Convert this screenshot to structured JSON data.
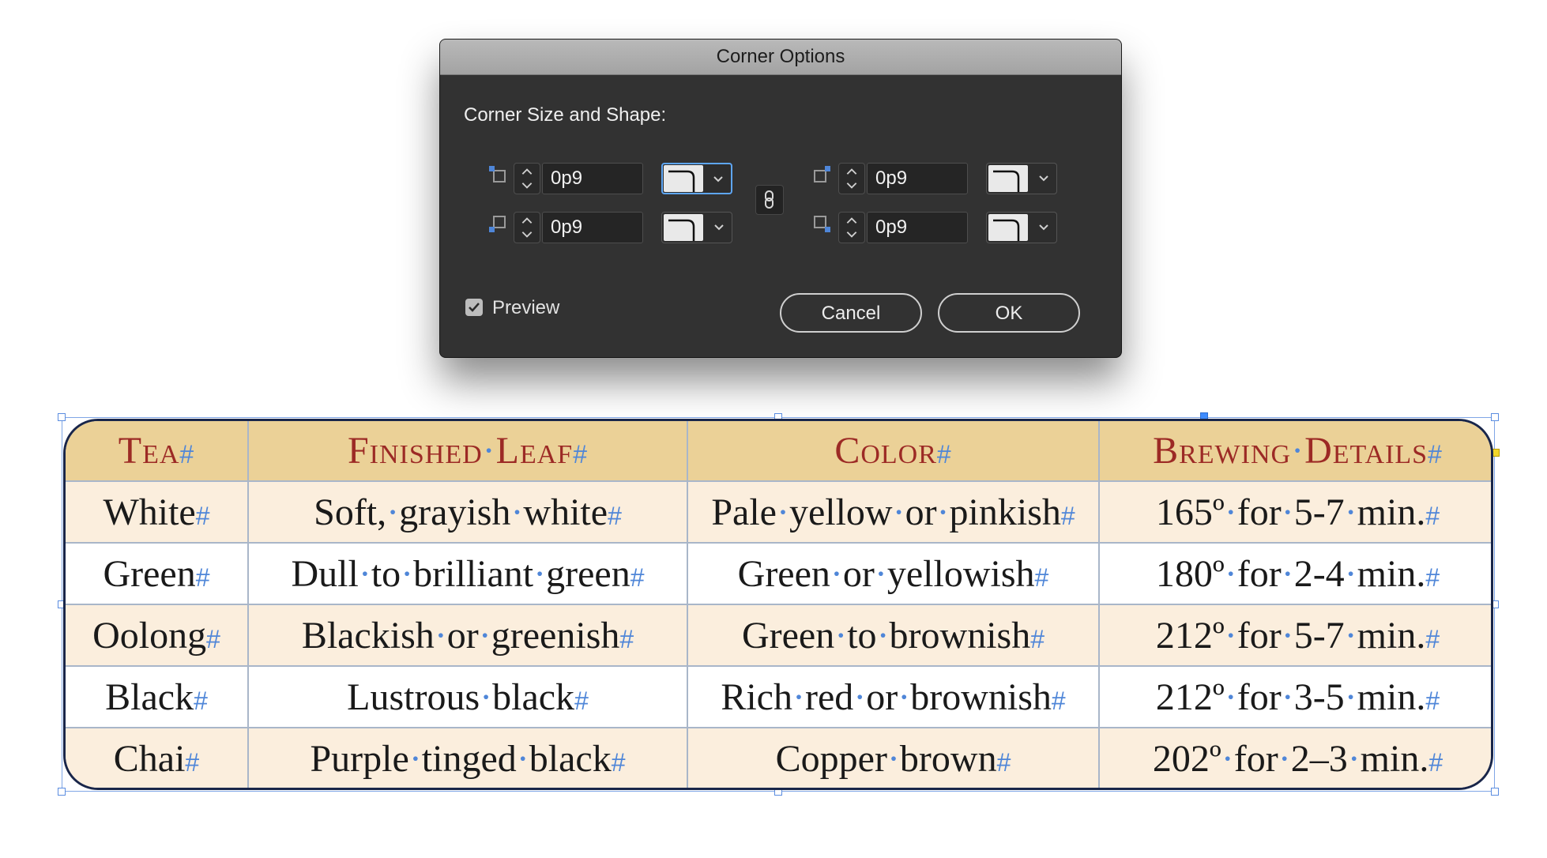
{
  "dialog": {
    "title": "Corner Options",
    "section_label": "Corner Size and Shape:",
    "corners": {
      "top_left": {
        "value": "0p9"
      },
      "top_right": {
        "value": "0p9"
      },
      "bottom_left": {
        "value": "0p9"
      },
      "bottom_right": {
        "value": "0p9"
      }
    },
    "preview": {
      "label": "Preview",
      "checked": true
    },
    "cancel_label": "Cancel",
    "ok_label": "OK",
    "colors": {
      "dialog_bg": "#323232",
      "focus_ring": "#5ea6f5",
      "corner_icon_accent": "#4f86d8"
    }
  },
  "table": {
    "pilcrow": "#",
    "headers": [
      "Tea",
      "Finished Leaf",
      "Color",
      "Brewing Details"
    ],
    "rows": [
      [
        "White",
        "Soft, grayish white",
        "Pale yellow or pinkish",
        "165º for 5-7 min."
      ],
      [
        "Green",
        "Dull to brilliant green",
        "Green or yellowish",
        "180º for 2-4 min."
      ],
      [
        "Oolong",
        "Blackish or greenish",
        "Green to brownish",
        "212º for 5-7 min."
      ],
      [
        "Black",
        "Lustrous black",
        "Rich red or brownish",
        "212º for 3-5 min."
      ],
      [
        "Chai",
        "Purple tinged black",
        "Copper brown",
        "202º for 2–3 min."
      ]
    ],
    "colors": {
      "header_bg": "#ebd197",
      "header_text": "#9c2a25",
      "row_tint": "#fbeedd",
      "border": "#19264a",
      "hidden_char": "#4f86d8"
    }
  }
}
